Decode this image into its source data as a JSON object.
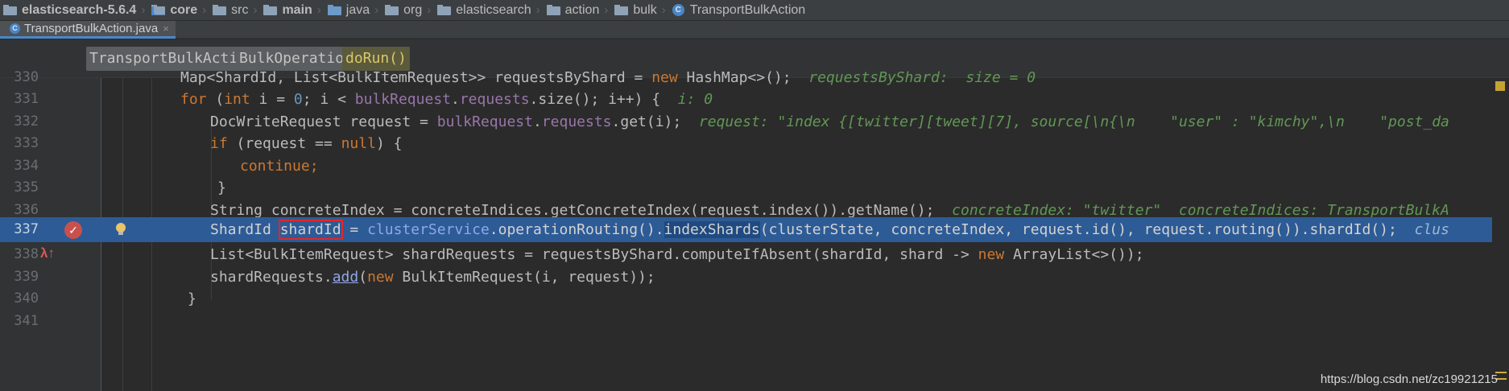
{
  "breadcrumb": [
    {
      "label": "elasticsearch-5.6.4",
      "icon": "project-folder-icon"
    },
    {
      "label": "core",
      "icon": "module-folder-icon"
    },
    {
      "label": "src",
      "icon": "folder-icon"
    },
    {
      "label": "main",
      "icon": "folder-icon"
    },
    {
      "label": "java",
      "icon": "source-folder-icon"
    },
    {
      "label": "org",
      "icon": "package-icon"
    },
    {
      "label": "elasticsearch",
      "icon": "package-icon"
    },
    {
      "label": "action",
      "icon": "package-icon"
    },
    {
      "label": "bulk",
      "icon": "package-icon"
    },
    {
      "label": "TransportBulkAction",
      "icon": "class-icon"
    }
  ],
  "tab": {
    "label": "TransportBulkAction.java",
    "close": "×"
  },
  "structure": [
    "TransportBulkAction",
    "BulkOperation",
    "doRun()"
  ],
  "lines": {
    "330": "330",
    "331": "331",
    "332": "332",
    "333": "333",
    "334": "334",
    "335": "335",
    "336": "336",
    "337": "337",
    "338": "338",
    "339": "339",
    "340": "340",
    "341": "341"
  },
  "code": {
    "l330": {
      "a": "Map<ShardId, List<BulkItemRequest>> requestsByShard = ",
      "kw": "new",
      "b": " HashMap<>();",
      "hint": "requestsByShard:  size = 0"
    },
    "l331": {
      "kw1": "for",
      "a": " (",
      "kw2": "int",
      "b": " i = ",
      "num": "0",
      "c": "; i < ",
      "f1": "bulkRequest",
      "d": ".",
      "f2": "requests",
      "e": ".size(); i++) {",
      "hint": "i: 0"
    },
    "l332": {
      "a": "DocWriteRequest request = ",
      "f1": "bulkRequest",
      "b": ".",
      "f2": "requests",
      "c": ".get(i);",
      "hint": "request: \"index {[twitter][tweet][7], source[\\n{\\n    \"user\" : \"kimchy\",\\n    \"post_da"
    },
    "l333": {
      "kw1": "if",
      "a": " (request == ",
      "kw2": "null",
      "b": ") {"
    },
    "l334": {
      "kw": "continue",
      "a": ";"
    },
    "l335": {
      "a": "}"
    },
    "l336": {
      "a": "String concreteIndex = concreteIndices.getConcreteIndex(request.index()).getName();",
      "hint": "concreteIndex: \"twitter\"  concreteIndices: TransportBulkA"
    },
    "l337": {
      "a": "ShardId ",
      "sel": "shardId",
      "b": " = ",
      "f1": "clusterService",
      "c": ".operationRouting().",
      "sel2": "indexShards",
      "d": "(clusterState, concreteIndex, request.id(), request.routing()).shardId();",
      "hint": "clus"
    },
    "l338": {
      "a": "List<BulkItemRequest> shardRequests = requestsByShard.computeIfAbsent(shardId, shard -> ",
      "kw": "new",
      "b": " ArrayList<>());"
    },
    "l339": {
      "a": "shardRequests.",
      "m": "add",
      "b": "(",
      "kw": "new",
      "c": " BulkItemRequest(i, request));"
    },
    "l340": {
      "a": "}"
    }
  },
  "watermark": "https://blog.csdn.net/zc19921215"
}
